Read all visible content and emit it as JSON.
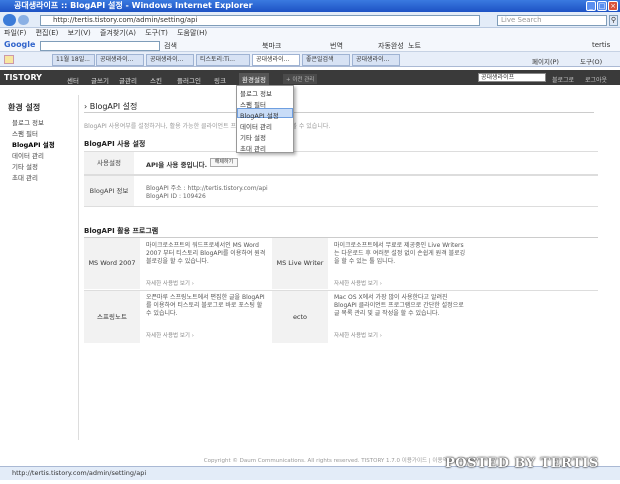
{
  "window": {
    "title": "공대생라이프 :: BlogAPI 설정 - Windows Internet Explorer"
  },
  "browser": {
    "url": "http://tertis.tistory.com/admin/setting/api",
    "search_placeholder": "Live Search",
    "menus": [
      "파일(F)",
      "편집(E)",
      "보기(V)",
      "즐겨찾기(A)",
      "도구(T)",
      "도움말(H)"
    ],
    "google_label": "Google",
    "google_tools": [
      "검색",
      "북마크",
      "번역",
      "자동완성",
      "노트"
    ],
    "google_user": "tertis",
    "tab_date": "11월 18일...",
    "tabs": [
      "공대생라이...",
      "공대생라이...",
      "티스토리:Ti...",
      "공대생라이...",
      "좋은일검색",
      "공대생라이..."
    ],
    "ie_tools": [
      "페이지(P)",
      "도구(O)"
    ],
    "status_url": "http://tertis.tistory.com/admin/setting/api"
  },
  "tistory": {
    "logo": "TISTORY",
    "nav": [
      "센터",
      "글쓰기",
      "글관리",
      "스킨",
      "플러그인",
      "링크",
      "환경설정"
    ],
    "badge": "+ 이전 관리",
    "blog_select": "공대생라이프",
    "right_links": [
      "블로그로",
      "로그아웃"
    ],
    "dropdown": [
      "블로그 정보",
      "스팸 필터",
      "BlogAPI 설정",
      "데이터 관리",
      "기타 설정",
      "초대 관리"
    ]
  },
  "sidebar": {
    "title": "환경 설정",
    "items": [
      "블로그 정보",
      "스팸 필터",
      "BlogAPI 설정",
      "데이터 관리",
      "기타 설정",
      "초대 관리"
    ]
  },
  "main": {
    "title": "› BlogAPI 설정",
    "description": "BlogAPI 사용여부를 설정하거나, 활용 가능한 클라이언트 프로그램에 대한 정보를 볼 수 있습니다.",
    "section1": "BlogAPI 사용 설정",
    "usage_label": "사용설정",
    "usage_value": "API을 사용 중입니다.",
    "usage_button": "해제하기",
    "info_label": "BlogAPI 정보",
    "info_addr": "BlogAPI 주소 : http://tertis.tistory.com/api",
    "info_id": "BlogAPI ID : 109426",
    "section2": "BlogAPI 활용 프로그램",
    "programs": [
      {
        "name": "MS Word 2007",
        "desc": "마이크로소프트의 워드프로세서인 MS Word 2007 부터 티스토리 BlogAPI를 이용하여 원격 블로깅을 할 수 있습니다.",
        "link": "자세한 사용법 보기 ›"
      },
      {
        "name": "MS Live Writer",
        "desc": "마이크로소프트에서 무료로 제공중인 Live Writers는 다운로드 후 여러분 설정 없이 손쉽게 원격 블로깅을 할 수 있는 툴 입니다.",
        "link": "자세한 사용법 보기 ›"
      },
      {
        "name": "스프링노트",
        "desc": "오픈마루 스프링노트에서 편집한 글을 BlogAPI를 이용하여 티스토리 블로그로 바로 포스팅 할 수 있습니다.",
        "link": "자세한 사용법 보기 ›"
      },
      {
        "name": "ecto",
        "desc": "Mac OS X에서 가장 많이 사용한다고 알려진 BlogAPI 클라이언트 프로그램으로 간단한 설정으로 글 목록 관리 및 글 작성을 할 수 있습니다.",
        "link": "자세한 사용법 보기 ›"
      }
    ],
    "footer": "Copyright © Daum Communications. All rights reserved. TISTORY 1.7.0  이용가이드 | 이용약관 | 고객센터"
  },
  "watermark": "POSTED BY TERTIS"
}
